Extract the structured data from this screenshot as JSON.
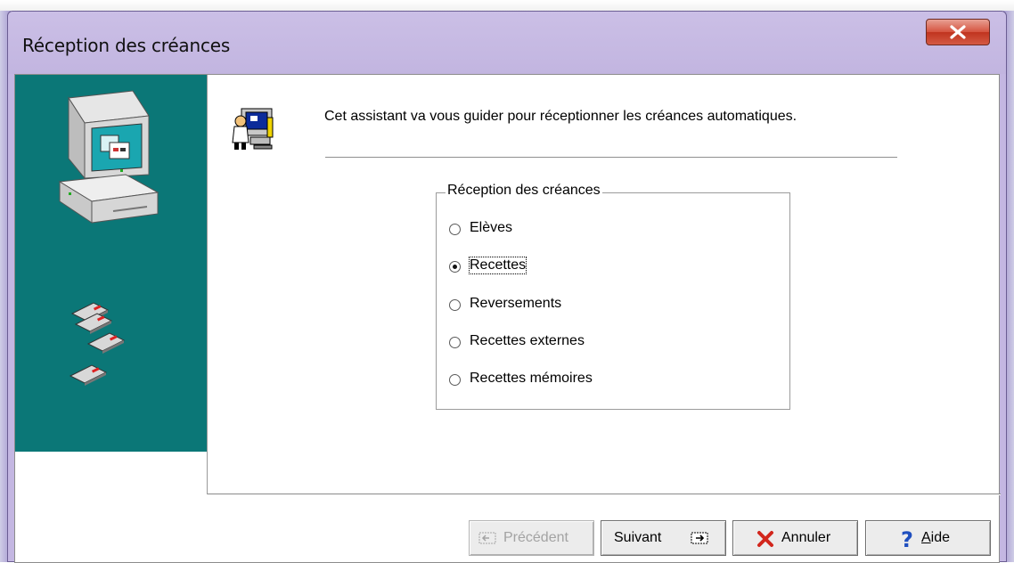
{
  "window": {
    "title": "Réception des créances",
    "close_label": "×"
  },
  "wizard": {
    "intro": "Cet assistant va vous guider pour réceptionner les créances automatiques."
  },
  "group": {
    "legend": "Réception des créances",
    "options": [
      {
        "label": "Elèves",
        "selected": false
      },
      {
        "label": "Recettes",
        "selected": true
      },
      {
        "label": "Reversements",
        "selected": false
      },
      {
        "label": "Recettes externes",
        "selected": false
      },
      {
        "label": "Recettes mémoires",
        "selected": false
      }
    ]
  },
  "buttons": {
    "previous": "Précédent",
    "next": "Suivant",
    "cancel": "Annuler",
    "help_first": "A",
    "help_rest": "ide"
  },
  "colors": {
    "side_panel": "#0b7777",
    "cancel_icon": "#d2261c",
    "help_icon": "#1f4fbf"
  }
}
